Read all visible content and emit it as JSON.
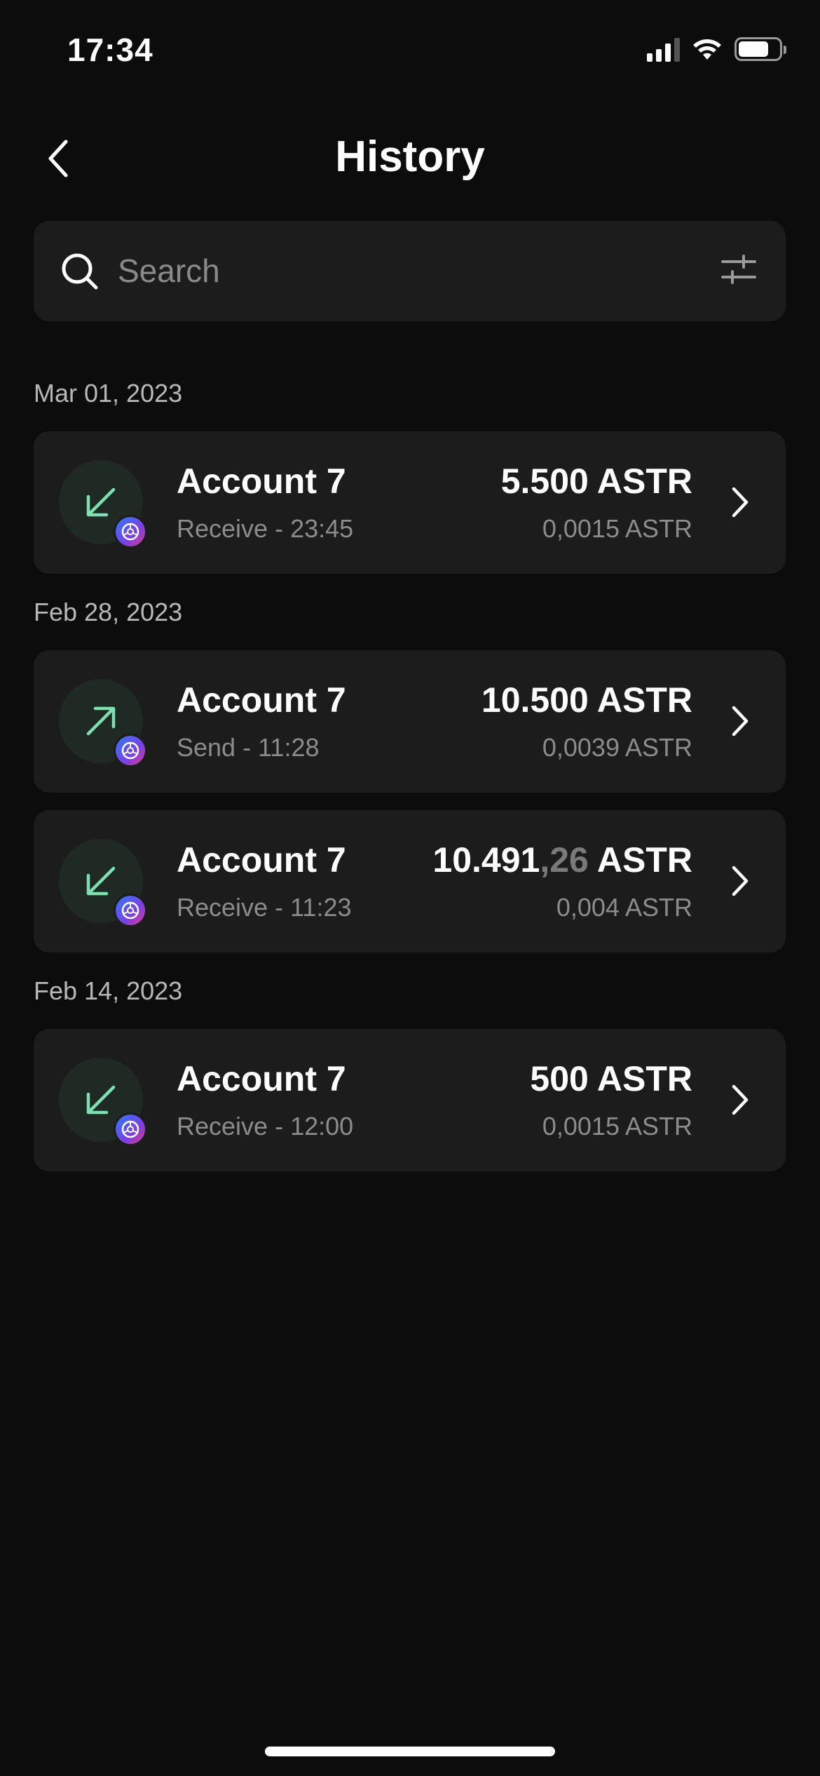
{
  "status_bar": {
    "time": "17:34"
  },
  "header": {
    "title": "History",
    "back_icon": "chevron-left-icon"
  },
  "search": {
    "placeholder": "Search",
    "value": "",
    "filter_icon": "sliders-icon"
  },
  "groups": [
    {
      "date": "Mar 01, 2023",
      "transactions": [
        {
          "direction": "receive",
          "account": "Account 7",
          "type": "Receive",
          "time": "- 23:45",
          "amount_main": "5.500",
          "amount_decimals": "",
          "amount_unit": "ASTR",
          "fee": "0,0015 ASTR"
        }
      ]
    },
    {
      "date": "Feb 28, 2023",
      "transactions": [
        {
          "direction": "send",
          "account": "Account 7",
          "type": "Send",
          "time": "- 11:28",
          "amount_main": "10.500",
          "amount_decimals": "",
          "amount_unit": "ASTR",
          "fee": "0,0039 ASTR"
        },
        {
          "direction": "receive",
          "account": "Account 7",
          "type": "Receive",
          "time": "- 11:23",
          "amount_main": "10.491",
          "amount_decimals": ",26",
          "amount_unit": "ASTR",
          "fee": "0,004 ASTR"
        }
      ]
    },
    {
      "date": "Feb 14, 2023",
      "transactions": [
        {
          "direction": "receive",
          "account": "Account 7",
          "type": "Receive",
          "time": "- 12:00",
          "amount_main": "500",
          "amount_decimals": "",
          "amount_unit": "ASTR",
          "fee": "0,0015 ASTR"
        }
      ]
    }
  ],
  "colors": {
    "background": "#0c0c0c",
    "card": "#1c1c1c",
    "accent_green": "#7ee0b0",
    "muted_text": "#8c8c8c"
  }
}
